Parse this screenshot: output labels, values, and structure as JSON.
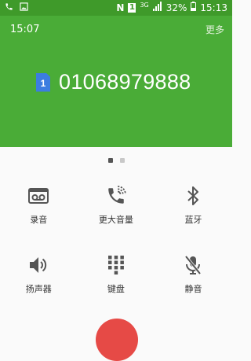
{
  "status_bar": {
    "sim_badge": "1",
    "network": "3G",
    "battery": "32%",
    "time": "15:13",
    "icons": [
      "phone-icon",
      "image-icon",
      "nfc-icon",
      "sim-badge",
      "signal-icon",
      "battery-icon"
    ]
  },
  "call": {
    "duration": "15:07",
    "more_label": "更多",
    "sim_slot": "1",
    "number": "01068979888"
  },
  "pager": {
    "pages": 2,
    "active": 0
  },
  "actions": [
    {
      "label": "录音",
      "icon": "record-icon"
    },
    {
      "label": "更大音量",
      "icon": "volume-boost-icon"
    },
    {
      "label": "蓝牙",
      "icon": "bluetooth-icon"
    },
    {
      "label": "扬声器",
      "icon": "speaker-icon"
    },
    {
      "label": "键盘",
      "icon": "keypad-icon"
    },
    {
      "label": "静音",
      "icon": "mute-icon"
    }
  ],
  "colors": {
    "header": "#4aac37",
    "statusbar": "#3f9a2a",
    "end_call": "#e64a46",
    "sim": "#3c7de0"
  }
}
